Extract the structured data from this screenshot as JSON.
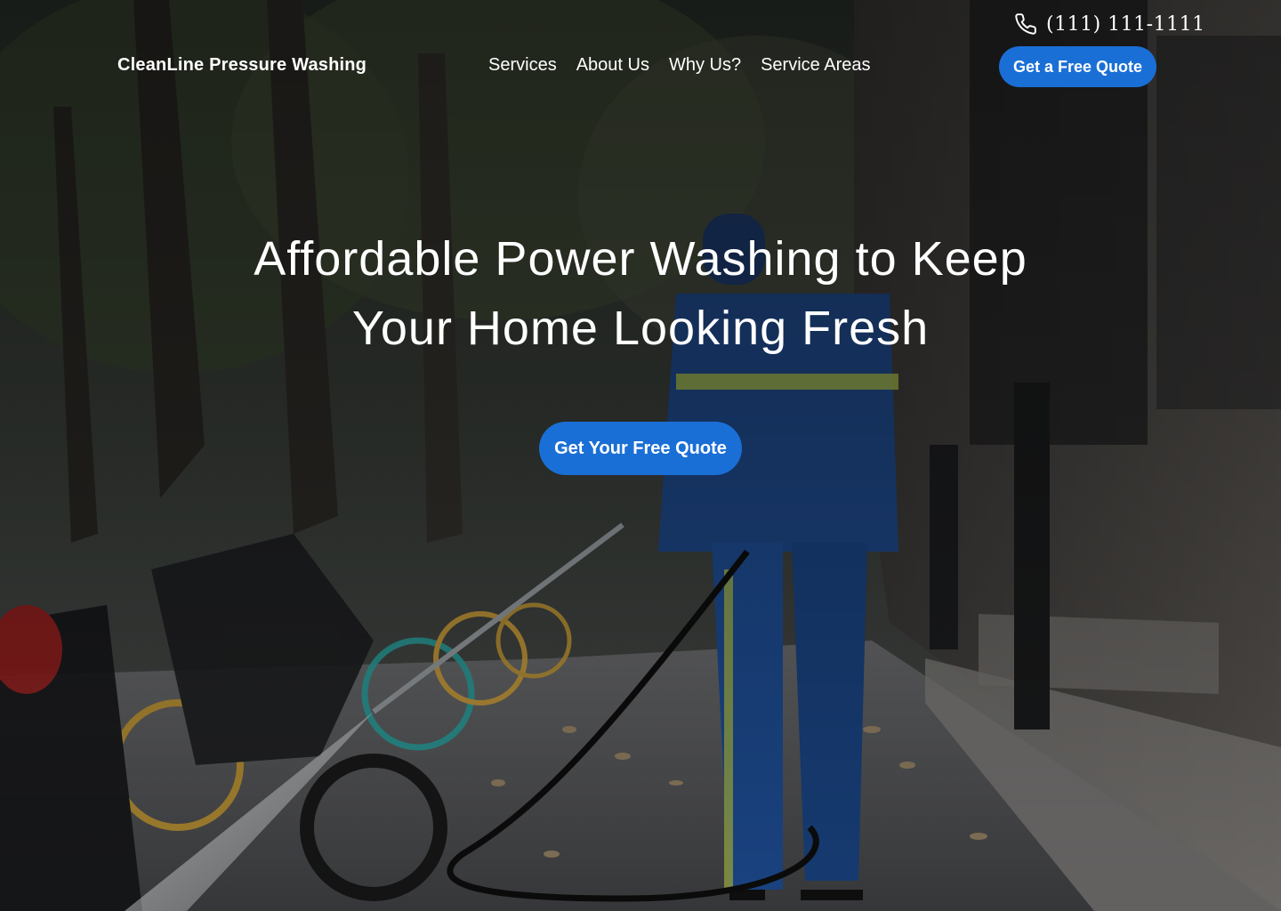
{
  "brand": {
    "name": "CleanLine Pressure Washing"
  },
  "header": {
    "phone": "(111) 111-1111",
    "nav": [
      {
        "label": "Services"
      },
      {
        "label": "About Us"
      },
      {
        "label": "Why Us?"
      },
      {
        "label": "Service Areas"
      }
    ],
    "cta_label": "Get a Free Quote"
  },
  "hero": {
    "headline_line1": "Affordable Power Washing to Keep",
    "headline_line2": "Your Home Looking Fresh",
    "cta_label": "Get Your Free Quote",
    "image_icon": "pressure-washing-photo"
  },
  "colors": {
    "accent": "#1a6fd6",
    "text": "#ffffff"
  },
  "icons": {
    "phone": "phone-icon"
  }
}
